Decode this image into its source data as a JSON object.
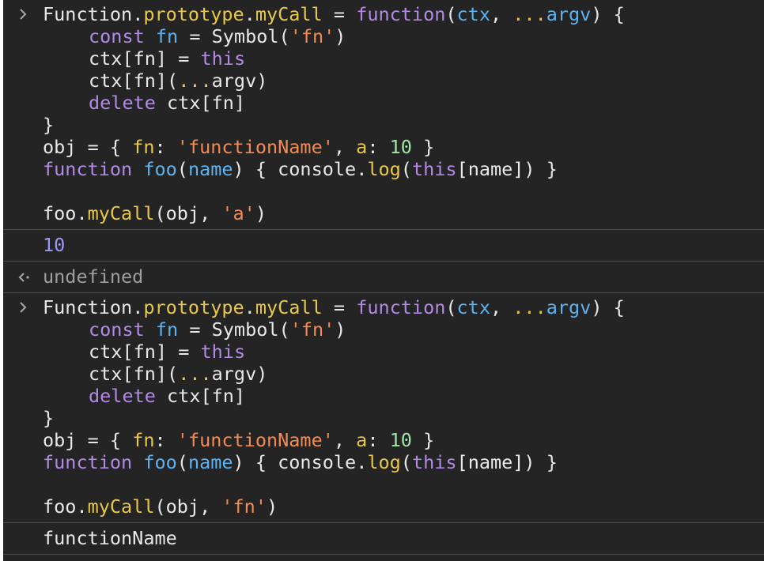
{
  "console": {
    "entries": [
      {
        "type": "input",
        "prompt_icon": "chevron-right-icon",
        "lines": [
          {
            "indent": 0,
            "tokens": [
              {
                "t": "Function",
                "c": "p"
              },
              {
                "t": ".",
                "c": "p"
              },
              {
                "t": "prototype",
                "c": "prop"
              },
              {
                "t": ".",
                "c": "p"
              },
              {
                "t": "myCall",
                "c": "prop"
              },
              {
                "t": " = ",
                "c": "p"
              },
              {
                "t": "function",
                "c": "kw"
              },
              {
                "t": "(",
                "c": "p"
              },
              {
                "t": "ctx",
                "c": "var"
              },
              {
                "t": ", ",
                "c": "p"
              },
              {
                "t": "...",
                "c": "spread"
              },
              {
                "t": "argv",
                "c": "var"
              },
              {
                "t": ") {",
                "c": "p"
              }
            ]
          },
          {
            "indent": 1,
            "tokens": [
              {
                "t": "const ",
                "c": "kw"
              },
              {
                "t": "fn",
                "c": "var"
              },
              {
                "t": " = ",
                "c": "p"
              },
              {
                "t": "Symbol",
                "c": "p"
              },
              {
                "t": "(",
                "c": "p"
              },
              {
                "t": "'fn'",
                "c": "str"
              },
              {
                "t": ")",
                "c": "p"
              }
            ]
          },
          {
            "indent": 1,
            "tokens": [
              {
                "t": "ctx[fn]",
                "c": "p"
              },
              {
                "t": " = ",
                "c": "p"
              },
              {
                "t": "this",
                "c": "kw"
              }
            ]
          },
          {
            "indent": 1,
            "tokens": [
              {
                "t": "ctx[fn](",
                "c": "p"
              },
              {
                "t": "...",
                "c": "spread"
              },
              {
                "t": "argv)",
                "c": "p"
              }
            ]
          },
          {
            "indent": 1,
            "tokens": [
              {
                "t": "delete ",
                "c": "kw"
              },
              {
                "t": "ctx[fn]",
                "c": "p"
              }
            ]
          },
          {
            "indent": 0,
            "tokens": [
              {
                "t": "}",
                "c": "p"
              }
            ]
          },
          {
            "indent": 0,
            "tokens": [
              {
                "t": "obj",
                "c": "p"
              },
              {
                "t": " = { ",
                "c": "p"
              },
              {
                "t": "fn",
                "c": "prop"
              },
              {
                "t": ": ",
                "c": "p"
              },
              {
                "t": "'functionName'",
                "c": "str"
              },
              {
                "t": ", ",
                "c": "p"
              },
              {
                "t": "a",
                "c": "prop"
              },
              {
                "t": ": ",
                "c": "p"
              },
              {
                "t": "10",
                "c": "num"
              },
              {
                "t": " }",
                "c": "p"
              }
            ]
          },
          {
            "indent": 0,
            "tokens": [
              {
                "t": "function ",
                "c": "kw"
              },
              {
                "t": "foo",
                "c": "var"
              },
              {
                "t": "(",
                "c": "p"
              },
              {
                "t": "name",
                "c": "var"
              },
              {
                "t": ") { ",
                "c": "p"
              },
              {
                "t": "console",
                "c": "p"
              },
              {
                "t": ".",
                "c": "p"
              },
              {
                "t": "log",
                "c": "prop"
              },
              {
                "t": "(",
                "c": "p"
              },
              {
                "t": "this",
                "c": "kw"
              },
              {
                "t": "[name]) }",
                "c": "p"
              }
            ]
          },
          {
            "indent": 0,
            "tokens": []
          },
          {
            "indent": 0,
            "tokens": [
              {
                "t": "foo",
                "c": "p"
              },
              {
                "t": ".",
                "c": "p"
              },
              {
                "t": "myCall",
                "c": "prop"
              },
              {
                "t": "(obj, ",
                "c": "p"
              },
              {
                "t": "'a'",
                "c": "str"
              },
              {
                "t": ")",
                "c": "p"
              }
            ]
          }
        ]
      },
      {
        "type": "log",
        "text": "10",
        "style": "num-out"
      },
      {
        "type": "result",
        "prompt_icon": "return-arrow-icon",
        "text": "undefined",
        "style": "undef"
      },
      {
        "type": "input",
        "prompt_icon": "chevron-right-icon",
        "lines": [
          {
            "indent": 0,
            "tokens": [
              {
                "t": "Function",
                "c": "p"
              },
              {
                "t": ".",
                "c": "p"
              },
              {
                "t": "prototype",
                "c": "prop"
              },
              {
                "t": ".",
                "c": "p"
              },
              {
                "t": "myCall",
                "c": "prop"
              },
              {
                "t": " = ",
                "c": "p"
              },
              {
                "t": "function",
                "c": "kw"
              },
              {
                "t": "(",
                "c": "p"
              },
              {
                "t": "ctx",
                "c": "var"
              },
              {
                "t": ", ",
                "c": "p"
              },
              {
                "t": "...",
                "c": "spread"
              },
              {
                "t": "argv",
                "c": "var"
              },
              {
                "t": ") {",
                "c": "p"
              }
            ]
          },
          {
            "indent": 1,
            "tokens": [
              {
                "t": "const ",
                "c": "kw"
              },
              {
                "t": "fn",
                "c": "var"
              },
              {
                "t": " = ",
                "c": "p"
              },
              {
                "t": "Symbol",
                "c": "p"
              },
              {
                "t": "(",
                "c": "p"
              },
              {
                "t": "'fn'",
                "c": "str"
              },
              {
                "t": ")",
                "c": "p"
              }
            ]
          },
          {
            "indent": 1,
            "tokens": [
              {
                "t": "ctx[fn]",
                "c": "p"
              },
              {
                "t": " = ",
                "c": "p"
              },
              {
                "t": "this",
                "c": "kw"
              }
            ]
          },
          {
            "indent": 1,
            "tokens": [
              {
                "t": "ctx[fn](",
                "c": "p"
              },
              {
                "t": "...",
                "c": "spread"
              },
              {
                "t": "argv)",
                "c": "p"
              }
            ]
          },
          {
            "indent": 1,
            "tokens": [
              {
                "t": "delete ",
                "c": "kw"
              },
              {
                "t": "ctx[fn]",
                "c": "p"
              }
            ]
          },
          {
            "indent": 0,
            "tokens": [
              {
                "t": "}",
                "c": "p"
              }
            ]
          },
          {
            "indent": 0,
            "tokens": [
              {
                "t": "obj",
                "c": "p"
              },
              {
                "t": " = { ",
                "c": "p"
              },
              {
                "t": "fn",
                "c": "prop"
              },
              {
                "t": ": ",
                "c": "p"
              },
              {
                "t": "'functionName'",
                "c": "str"
              },
              {
                "t": ", ",
                "c": "p"
              },
              {
                "t": "a",
                "c": "prop"
              },
              {
                "t": ": ",
                "c": "p"
              },
              {
                "t": "10",
                "c": "num"
              },
              {
                "t": " }",
                "c": "p"
              }
            ]
          },
          {
            "indent": 0,
            "tokens": [
              {
                "t": "function ",
                "c": "kw"
              },
              {
                "t": "foo",
                "c": "var"
              },
              {
                "t": "(",
                "c": "p"
              },
              {
                "t": "name",
                "c": "var"
              },
              {
                "t": ") { ",
                "c": "p"
              },
              {
                "t": "console",
                "c": "p"
              },
              {
                "t": ".",
                "c": "p"
              },
              {
                "t": "log",
                "c": "prop"
              },
              {
                "t": "(",
                "c": "p"
              },
              {
                "t": "this",
                "c": "kw"
              },
              {
                "t": "[name]) }",
                "c": "p"
              }
            ]
          },
          {
            "indent": 0,
            "tokens": []
          },
          {
            "indent": 0,
            "tokens": [
              {
                "t": "foo",
                "c": "p"
              },
              {
                "t": ".",
                "c": "p"
              },
              {
                "t": "myCall",
                "c": "prop"
              },
              {
                "t": "(obj, ",
                "c": "p"
              },
              {
                "t": "'fn'",
                "c": "str"
              },
              {
                "t": ")",
                "c": "p"
              }
            ]
          }
        ]
      },
      {
        "type": "log",
        "text": "functionName",
        "style": "p"
      }
    ]
  },
  "colors": {
    "background": "#242424",
    "keyword": "#b28ae6",
    "property": "#e8c84a",
    "variable": "#5db3f0",
    "string": "#f28b54",
    "number": "#9ee6a6",
    "log_number": "#9f96f6",
    "undefined": "#9e9e9e"
  }
}
